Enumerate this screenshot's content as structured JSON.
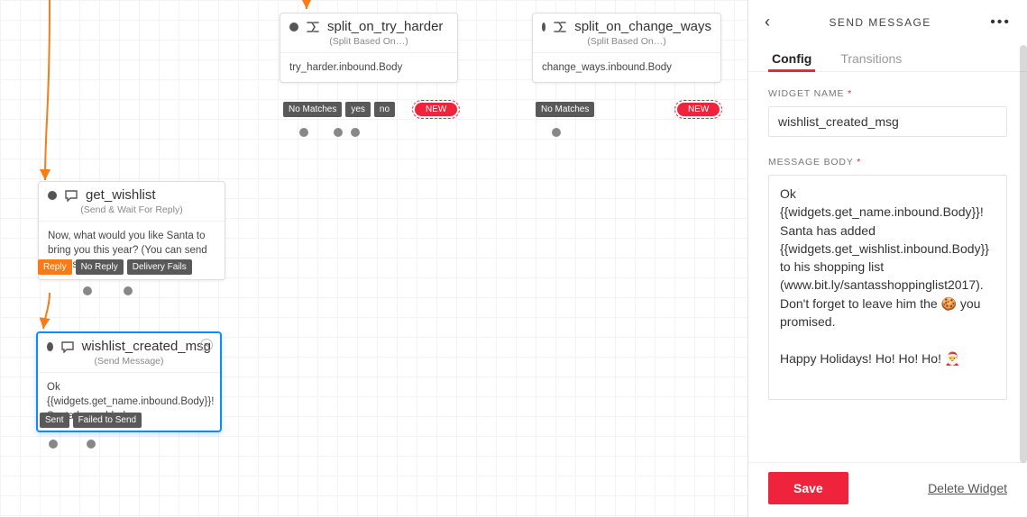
{
  "canvas": {
    "nodes": {
      "split_try_harder": {
        "title": "split_on_try_harder",
        "subtitle": "(Split Based On…)",
        "body": "try_harder.inbound.Body"
      },
      "split_change_ways": {
        "title": "split_on_change_ways",
        "subtitle": "(Split Based On…)",
        "body": "change_ways.inbound.Body"
      },
      "get_wishlist": {
        "title": "get_wishlist",
        "subtitle": "(Send & Wait For Reply)",
        "body": "Now, what would you like Santa to bring you this year? (You can send emojis too,…"
      },
      "wishlist_created_msg": {
        "title": "wishlist_created_msg",
        "subtitle": "(Send Message)",
        "body": "Ok {{widgets.get_name.inbound.Body}}! Santa has added  …"
      }
    },
    "chips": {
      "no_matches": "No Matches",
      "yes": "yes",
      "no": "no",
      "new": "NEW",
      "reply": "Reply",
      "no_reply": "No Reply",
      "delivery_fails": "Delivery Fails",
      "sent": "Sent",
      "failed_to_send": "Failed to Send"
    }
  },
  "panel": {
    "header": {
      "title": "SEND MESSAGE"
    },
    "tabs": {
      "config": "Config",
      "transitions": "Transitions"
    },
    "config": {
      "widget_name_label": "WIDGET NAME",
      "widget_name_value": "wishlist_created_msg",
      "message_body_label": "MESSAGE BODY",
      "message_body_value": "Ok {{widgets.get_name.inbound.Body}}! Santa has added {{widgets.get_wishlist.inbound.Body}} to his shopping list (www.bit.ly/santasshoppinglist2017). Don't forget to leave him the 🍪 you promised.\n\nHappy Holidays! Ho! Ho! Ho! 🎅"
    },
    "footer": {
      "save": "Save",
      "delete": "Delete Widget"
    }
  }
}
